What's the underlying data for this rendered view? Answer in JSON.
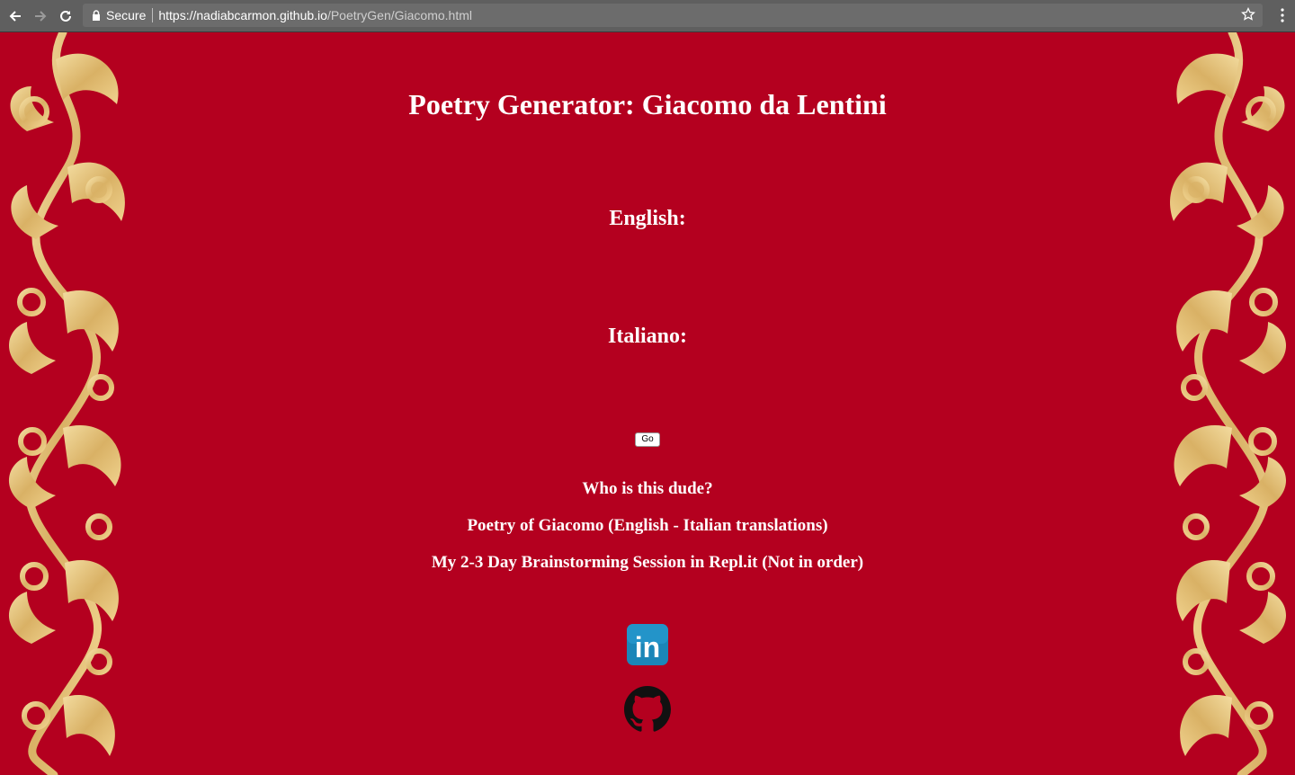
{
  "browser": {
    "secure_label": "Secure",
    "url_host": "https://nadiabcarmon.github.io",
    "url_path": "/PoetryGen/Giacomo.html",
    "icons": [
      "back-arrow-icon",
      "forward-arrow-icon",
      "reload-icon",
      "lock-icon",
      "star-icon",
      "menu-dots-icon"
    ]
  },
  "page": {
    "title": "Poetry Generator: Giacomo da Lentini",
    "english_label": "English:",
    "italian_label": "Italiano:",
    "go_button": "Go",
    "links": [
      "Who is this dude?",
      "Poetry of Giacomo (English - Italian translations)",
      "My 2-3 Day Brainstorming Session in Repl.it (Not in order)"
    ],
    "linkedin_text": "in"
  },
  "colors": {
    "background": "#b4001f",
    "ornament_gold": "#e3c27a",
    "linkedin_blue": "#1b86b8",
    "github_black": "#111111"
  }
}
